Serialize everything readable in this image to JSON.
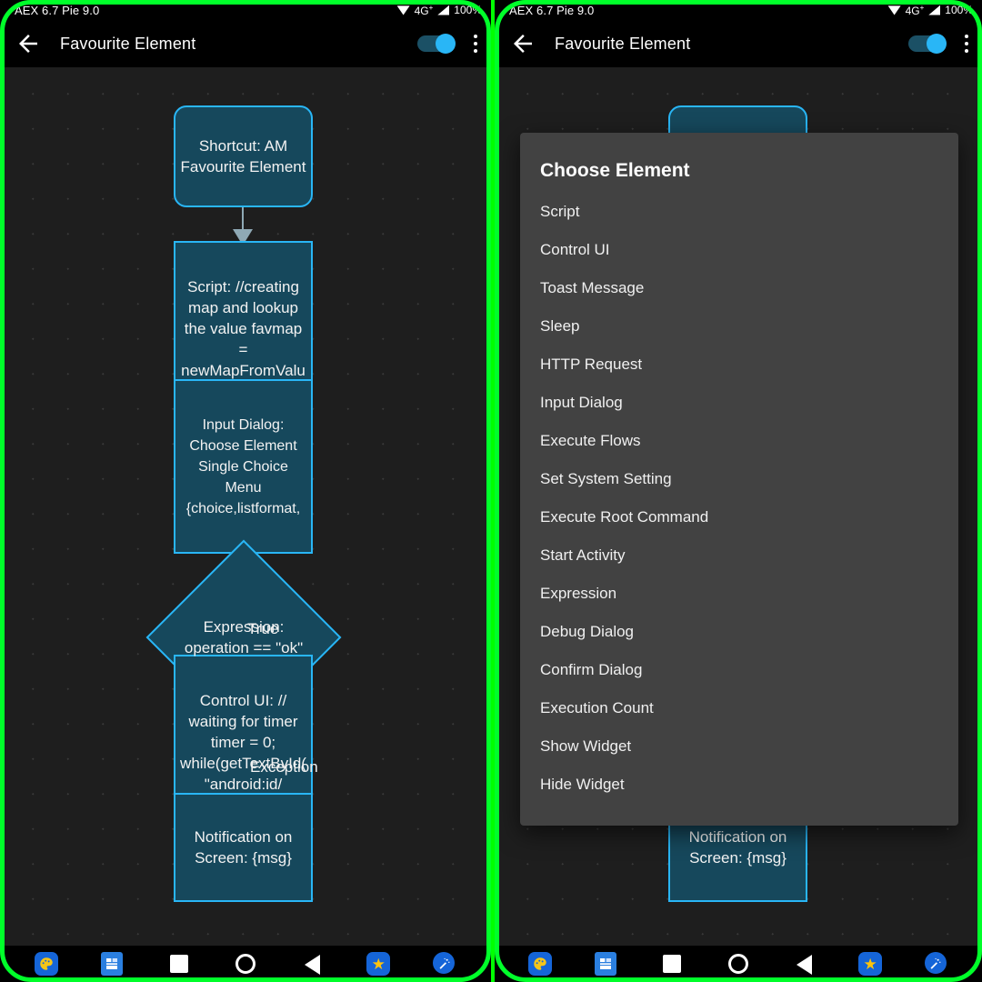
{
  "status_bar": {
    "rom_label": "AEX 6.7 Pie 9.0",
    "network": "4G",
    "network_sup": "+",
    "battery": "100%"
  },
  "toolbar": {
    "back_icon": "back-arrow-icon",
    "title": "Favourite Element",
    "toggle_state": "on",
    "overflow_icon": "kebab-menu-icon"
  },
  "flow": {
    "nodes": [
      {
        "id": "start",
        "shape": "rounded",
        "text": "Shortcut: AM\nFavourite Element"
      },
      {
        "id": "script",
        "shape": "rect",
        "text": "Script: //creating\nmap and lookup\nthe value favmap\n=\nnewMapFromValu"
      },
      {
        "id": "input",
        "shape": "rect",
        "text": "Input Dialog:\nChoose Element\nSingle Choice\nMenu\n{choice,listformat,"
      },
      {
        "id": "expr",
        "shape": "diamond",
        "text": "Expression:\noperation == \"ok\""
      },
      {
        "id": "control",
        "shape": "rect",
        "text": "Control UI: //\nwaiting for timer\ntimer = 0;\nwhile(getTextById(\n\"android:id/"
      },
      {
        "id": "notify",
        "shape": "rect",
        "text": "Notification on\nScreen: {msg}"
      }
    ],
    "edge_labels": {
      "true": "True",
      "exception": "Exception"
    }
  },
  "dialog": {
    "title": "Choose Element",
    "items": [
      "Script",
      "Control UI",
      "Toast Message",
      "Sleep",
      "HTTP Request",
      "Input Dialog",
      "Execute Flows",
      "Set System Setting",
      "Execute Root Command",
      "Start Activity",
      "Expression",
      "Debug Dialog",
      "Confirm Dialog",
      "Execution Count",
      "Show Widget",
      "Hide Widget"
    ]
  },
  "navbar": {
    "items": [
      {
        "name": "palette-app-icon",
        "glyph": "🎨"
      },
      {
        "name": "calculator-app-icon",
        "glyph": "➗"
      },
      {
        "name": "recents-square-icon",
        "glyph": ""
      },
      {
        "name": "home-circle-icon",
        "glyph": ""
      },
      {
        "name": "back-triangle-icon",
        "glyph": ""
      },
      {
        "name": "favourite-star-icon",
        "glyph": "★"
      },
      {
        "name": "magic-wand-icon",
        "glyph": "✦"
      }
    ]
  },
  "colors": {
    "accent": "#29b6f6",
    "node_fill": "#16485c",
    "canvas_bg": "#1e1e1e",
    "dialog_bg": "#424242",
    "exception": "#b08585",
    "frame": "#00ff2a"
  }
}
